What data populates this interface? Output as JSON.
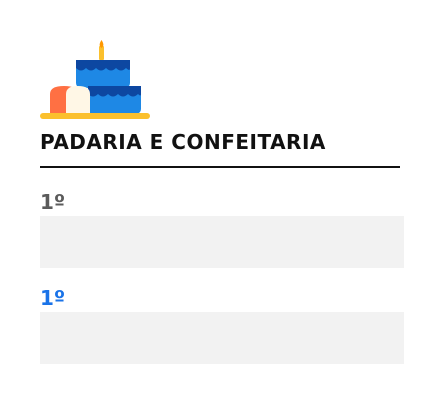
{
  "brand": {
    "title": "PADARIA E CONFEITARIA",
    "logo_icon": "cake-bread-icon",
    "colors": {
      "cake_blue": "#1e88e5",
      "cake_dark_blue": "#0d47a1",
      "tray_yellow": "#fbc02d",
      "bread_orange": "#ff7043",
      "candle_flame": "#ff9800"
    }
  },
  "entries": [
    {
      "rank": "1º",
      "value": ""
    },
    {
      "rank": "1º",
      "value": ""
    }
  ],
  "accent": "#1a73e8"
}
